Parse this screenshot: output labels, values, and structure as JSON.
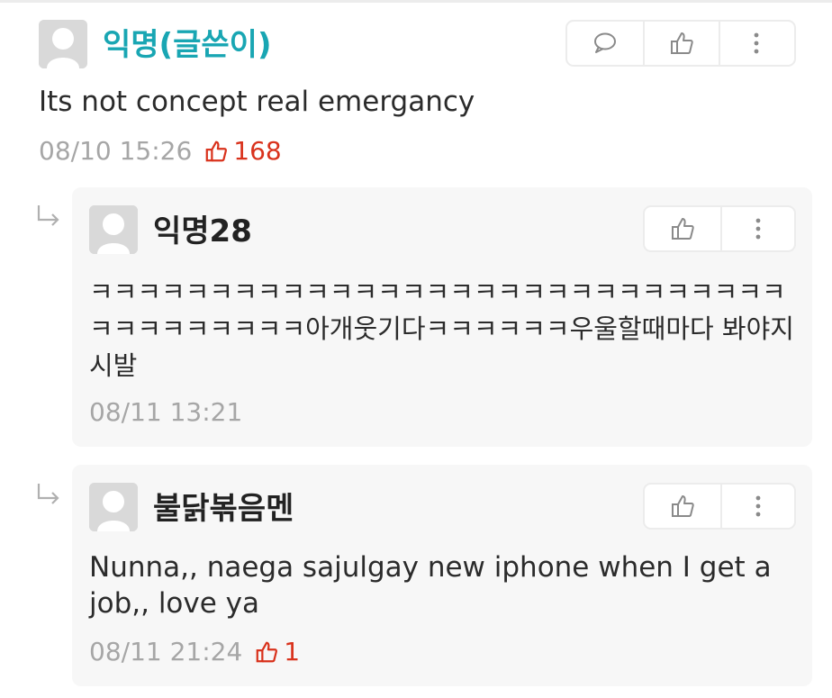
{
  "comments": [
    {
      "author": "익명(글쓴이)",
      "body": "Its not concept real emergancy",
      "timestamp": "08/10 15:26",
      "likes": "168"
    }
  ],
  "replies": [
    {
      "author": "익명28",
      "body": "ㅋㅋㅋㅋㅋㅋㅋㅋㅋㅋㅋㅋㅋㅋㅋㅋㅋㅋㅋㅋㅋㅋㅋㅋㅋㅋㅋㅋㅋㅋㅋㅋㅋㅋㅋㅋㅋㅋ아개웃기다ㅋㅋㅋㅋㅋㅋ우울할때마다 봐야지 시발",
      "timestamp": "08/11 13:21"
    },
    {
      "author": "불닭볶음멘",
      "body": "Nunna,, naega sajulgay new iphone when I get a job,, love ya",
      "timestamp": "08/11 21:24",
      "likes": "1"
    }
  ],
  "colors": {
    "op_author": "#19a6b3",
    "like_red": "#d9321c",
    "meta_gray": "#a6a6a6",
    "reply_bg": "#f7f7f7"
  },
  "icons": [
    "avatar-placeholder-icon",
    "comment-bubble-icon",
    "thumbs-up-icon",
    "more-vertical-icon",
    "reply-arrow-icon"
  ]
}
